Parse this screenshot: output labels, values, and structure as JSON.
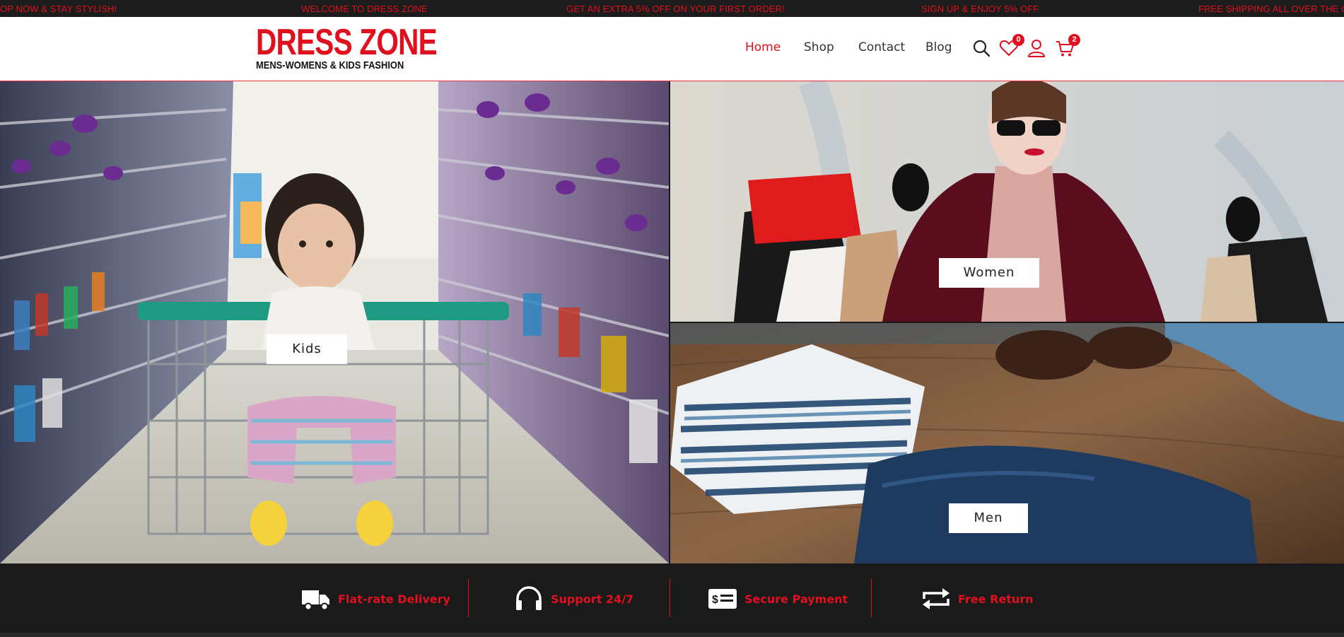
{
  "ticker": {
    "messages": [
      "OP NOW & STAY STYLISH!",
      "WELCOME TO DRESS ZONE",
      "GET AN EXTRA 5% OFF ON YOUR FIRST ORDER!",
      "SIGN UP & ENJOY 5% OFF",
      "FREE SHIPPING ALL OVER THE C"
    ]
  },
  "header": {
    "logo_title": "DRESS ZONE",
    "logo_subtitle": "MENS-WOMENS & KIDS FASHION",
    "nav": [
      "Home",
      "Shop",
      "Contact",
      "Blog"
    ],
    "active_nav": "Home",
    "wishlist_count": "0",
    "cart_count": "2",
    "icons": [
      "search-icon",
      "heart-icon",
      "user-icon",
      "cart-icon"
    ]
  },
  "hero": {
    "kids_label": "Kids",
    "women_label": "Women",
    "men_label": "Men"
  },
  "features": [
    {
      "label": "Flat-rate Delivery",
      "icon": "truck-icon"
    },
    {
      "label": "Support 24/7",
      "icon": "headphones-icon"
    },
    {
      "label": "Secure Payment",
      "icon": "payment-card-icon"
    },
    {
      "label": "Free Return",
      "icon": "return-arrows-icon"
    }
  ],
  "colors": {
    "accent": "#e0101e",
    "dark": "#1a1a1a"
  }
}
